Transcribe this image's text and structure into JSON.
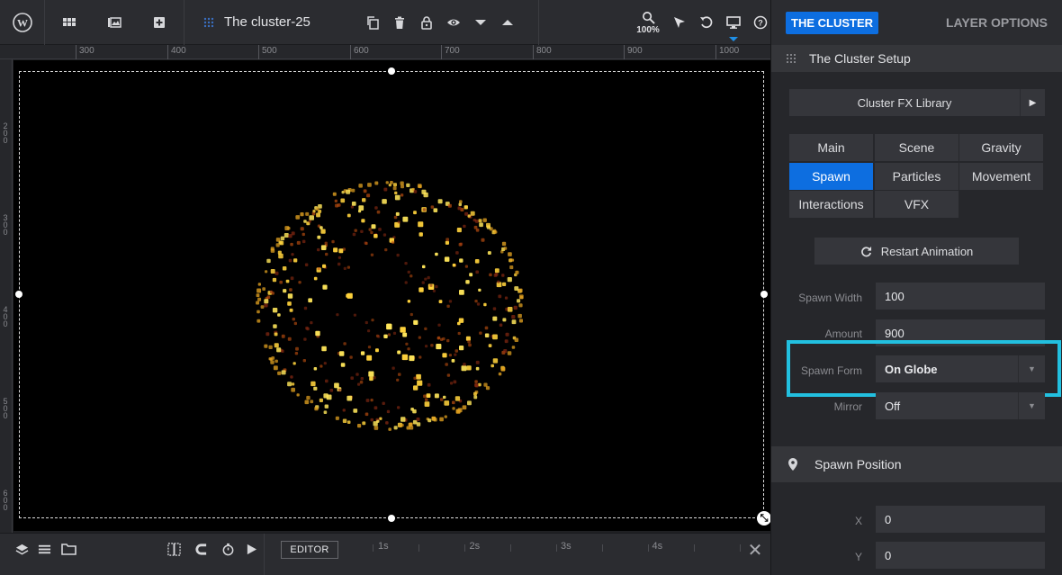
{
  "toolbar": {
    "title": "The cluster-25",
    "zoom": "100%",
    "icons": [
      "wordpress-icon",
      "grid-icon",
      "library-icon",
      "add-slide-icon",
      "layer-icon",
      "copy-icon",
      "trash-icon",
      "lock-icon",
      "eye-icon",
      "arrow-down-icon",
      "arrow-up-icon",
      "zoom-icon",
      "cursor-icon",
      "undo-icon",
      "monitor-icon",
      "help-icon"
    ]
  },
  "ruler": {
    "top_labels": [
      "300",
      "400",
      "500",
      "600",
      "700",
      "800",
      "900",
      "1000"
    ],
    "left_labels": [
      "200",
      "300",
      "400",
      "500",
      "600"
    ]
  },
  "bottombar": {
    "editor_label": "EDITOR",
    "timeline_marks": [
      "1s",
      "2s",
      "3s",
      "4s"
    ],
    "close": "✕"
  },
  "panel": {
    "tab_active": "THE CLUSTER",
    "tab_inactive": "LAYER OPTIONS",
    "setup_header": "The Cluster Setup",
    "fx_library": "Cluster FX Library",
    "tabs": [
      "Main",
      "Scene",
      "Gravity",
      "Spawn",
      "Particles",
      "Movement",
      "Interactions",
      "VFX"
    ],
    "active_tab": "Spawn",
    "restart_label": "Restart Animation",
    "fields": {
      "spawn_width": {
        "label": "Spawn Width",
        "value": "100"
      },
      "amount": {
        "label": "Amount",
        "value": "900"
      },
      "spawn_form": {
        "label": "Spawn Form",
        "value": "On Globe"
      },
      "mirror": {
        "label": "Mirror",
        "value": "Off"
      }
    },
    "spawn_position_header": "Spawn Position",
    "position": {
      "x": {
        "label": "X",
        "value": "0"
      },
      "y": {
        "label": "Y",
        "value": "0"
      }
    }
  },
  "colors": {
    "accent": "#0d6ee0",
    "highlight": "#22c0e0",
    "particle_colors": [
      "#ffd23c",
      "#ffe65a",
      "#e0a020",
      "#c05010",
      "#8a2a12"
    ]
  }
}
